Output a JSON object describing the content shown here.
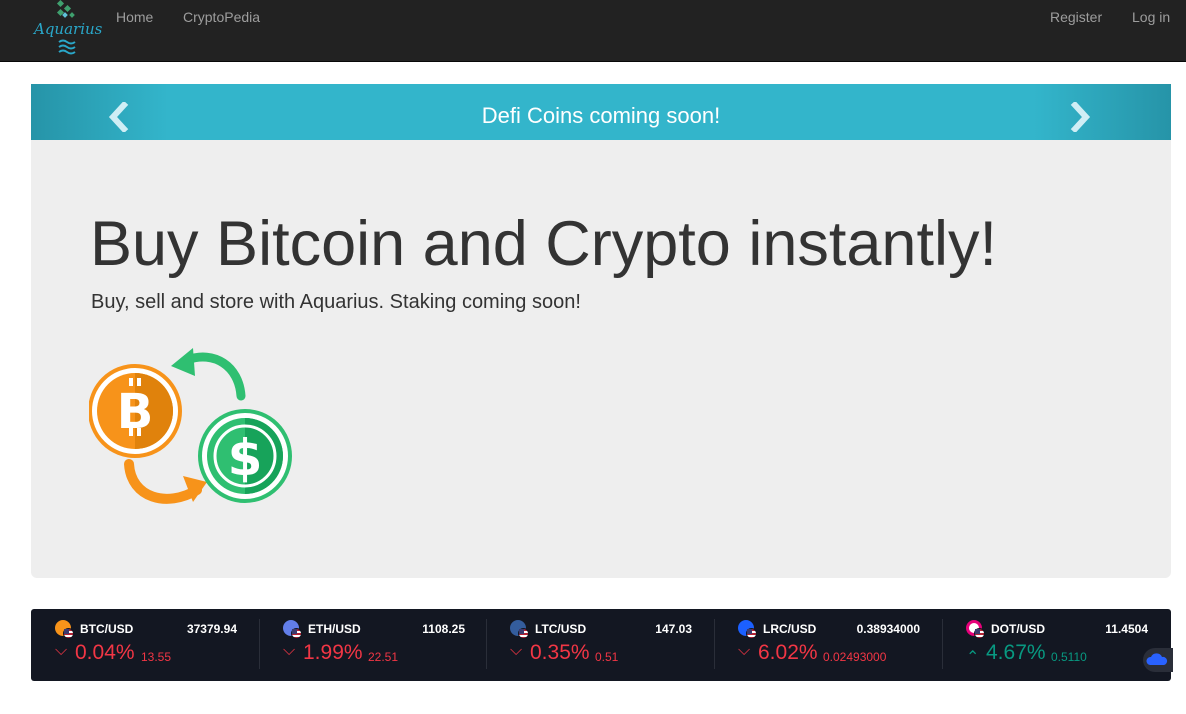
{
  "nav": {
    "brand": "Aquarius",
    "home": "Home",
    "cryptopedia": "CryptoPedia",
    "register": "Register",
    "login": "Log in"
  },
  "banner": {
    "title": "Defi Coins coming soon!",
    "prev_icon": "chevron-left-icon",
    "next_icon": "chevron-right-icon"
  },
  "hero": {
    "title": "Buy Bitcoin and Crypto instantly!",
    "subtitle": "Buy, sell and store with Aquarius. Staking coming soon!"
  },
  "ticker": [
    {
      "pair": "BTC/USD",
      "price": "37379.94",
      "pct": "0.04%",
      "abs": "13.55",
      "direction": "down",
      "coin_color": "#f7931a",
      "icon": "bitcoin-icon"
    },
    {
      "pair": "ETH/USD",
      "price": "1108.25",
      "pct": "1.99%",
      "abs": "22.51",
      "direction": "down",
      "coin_color": "#627eea",
      "icon": "ethereum-icon"
    },
    {
      "pair": "LTC/USD",
      "price": "147.03",
      "pct": "0.35%",
      "abs": "0.51",
      "direction": "down",
      "coin_color": "#345d9d",
      "icon": "litecoin-icon"
    },
    {
      "pair": "LRC/USD",
      "price": "0.38934000",
      "pct": "6.02%",
      "abs": "0.02493000",
      "direction": "down",
      "coin_color": "#1c60ff",
      "icon": "loopring-icon"
    },
    {
      "pair": "DOT/USD",
      "price": "11.4504",
      "pct": "4.67%",
      "abs": "0.5110",
      "direction": "up",
      "coin_color": "#e6007a",
      "icon": "polkadot-icon"
    }
  ],
  "colors": {
    "navbar": "#222222",
    "banner": "#33b5cb",
    "jumbotron": "#eeeeee",
    "ticker_bg": "#131722",
    "down": "#f23645",
    "up": "#089981"
  }
}
